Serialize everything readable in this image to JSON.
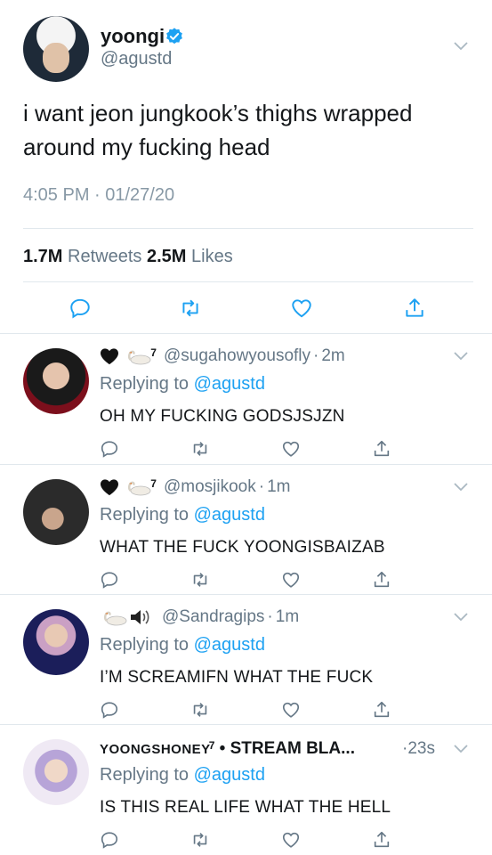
{
  "main_tweet": {
    "name": "yoongi",
    "handle": "@agustd",
    "text": "i want jeon jungkook’s thighs wrapped around my fucking head",
    "timestamp": "4:05 PM · 01/27/20",
    "retweets_count": "1.7M",
    "retweets_label": "Retweets",
    "likes_count": "2.5M",
    "likes_label": "Likes"
  },
  "replies": [
    {
      "emoji_badge": "7",
      "handle": "@sugahowyousofly",
      "dot": "·",
      "time": "2m",
      "replying_label": "Replying to",
      "replying_to": "@agustd",
      "text": "OH MY FUCKING GODSJSJZN"
    },
    {
      "emoji_badge": "7",
      "handle": "@mosjikook",
      "dot": "·",
      "time": "1m",
      "replying_label": "Replying to",
      "replying_to": "@agustd",
      "text": "WHAT THE FUCK YOONGISBAIZAB"
    },
    {
      "handle": "@Sandragips",
      "dot": "·",
      "time": "1m",
      "replying_label": "Replying to",
      "replying_to": "@agustd",
      "text": "I’M SCREAMIFN WHAT THE FUCK"
    },
    {
      "display_name_smallcaps": "YOONGSHONEY",
      "display_superscript": "7",
      "display_rest": " • STREAM BLA...",
      "dot": "·",
      "time": "23s",
      "replying_label": "Replying to",
      "replying_to": "@agustd",
      "text": "IS THIS REAL LIFE WHAT THE HELL"
    }
  ],
  "icons": [
    "reply-icon",
    "retweet-icon",
    "like-icon",
    "share-icon",
    "chevron-down-icon",
    "verified-icon",
    "black-heart-icon",
    "swan-icon",
    "speaker-icon"
  ],
  "colors": {
    "link": "#1da1f2",
    "muted": "#657786",
    "text": "#14171a",
    "divider": "#e1e8ed"
  }
}
